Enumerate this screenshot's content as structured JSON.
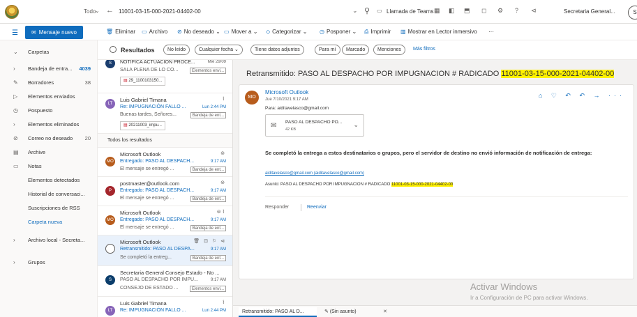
{
  "topbar": {
    "scope": "Todo",
    "search_value": "11001-03-15-000-2021-04402-00",
    "teams_label": "Llamada de Teams",
    "user": "Secretaria General...",
    "avatar": "S"
  },
  "commands": {
    "new_mail": "Mensaje nuevo",
    "delete": "Eliminar",
    "archive": "Archivo",
    "junk": "No deseado",
    "move": "Mover a",
    "categorize": "Categorizar",
    "snooze": "Posponer",
    "print": "Imprimir",
    "immersive": "Mostrar en Lector inmersivo",
    "more": "···"
  },
  "nav": {
    "folders": "Carpetas",
    "items": [
      {
        "icon": "chevron",
        "label": "Bandeja de entra...",
        "count": "4039"
      },
      {
        "icon": "pencil",
        "label": "Borradores",
        "count": "38"
      },
      {
        "icon": "send",
        "label": "Elementos enviados",
        "count": ""
      },
      {
        "icon": "clock",
        "label": "Pospuesto",
        "count": ""
      },
      {
        "icon": "chevron",
        "label": "Elementos eliminados",
        "count": ""
      },
      {
        "icon": "block",
        "label": "Correo no deseado",
        "count": "20"
      },
      {
        "icon": "archive",
        "label": "Archive",
        "count": ""
      },
      {
        "icon": "note",
        "label": "Notas",
        "count": ""
      },
      {
        "icon": "",
        "label": "Elementos detectados",
        "count": ""
      },
      {
        "icon": "",
        "label": "Historial de conversaci...",
        "count": ""
      },
      {
        "icon": "",
        "label": "Suscripciones de RSS",
        "count": ""
      },
      {
        "icon": "",
        "label": "Carpeta nueva",
        "count": ""
      }
    ],
    "local": "Archivo local - Secreta...",
    "groups": "Grupos"
  },
  "filters": {
    "title": "Resultados",
    "chips": [
      "No leído",
      "Cualquier fecha ⌄",
      "Tiene datos adjuntos",
      "Para mí",
      "Marcado",
      "Menciones"
    ],
    "more": "Más filtros"
  },
  "messages": {
    "m0": {
      "subject": "NOTIFICA ACTUACION PROCE...",
      "time": "Mié 29/09",
      "preview": "SALA PLENA DE LO CO...",
      "tag": "Elementos envi...",
      "attach": "29_1100103150..."
    },
    "m1": {
      "initials": "LT",
      "from": "Luis Gabriel Timana",
      "subject": "Re: IMPUGNACIÓN FALLO ...",
      "time": "Lun 2:44 PM",
      "preview": "Buenas tardes, Señores...",
      "tag": "Bandeja de ent...",
      "attach": "20211003_impu..."
    },
    "section": "Todos los resultados",
    "m2": {
      "initials": "MO",
      "from": "Microsoft Outlook",
      "subject": "Entregado: PASO AL DESPACH...",
      "time": "9:17 AM",
      "preview": "El mensaje se entregó ...",
      "tag": "Bandeja de ent..."
    },
    "m3": {
      "initials": "P",
      "from": "postmaster@outlook.com",
      "subject": "Entregado: PASO AL DESPACH...",
      "time": "9:17 AM",
      "preview": "El mensaje se entregó ...",
      "tag": "Bandeja de ent..."
    },
    "m4": {
      "initials": "MO",
      "from": "Microsoft Outlook",
      "subject": "Entregado: PASO AL DESPACH...",
      "time": "9:17 AM",
      "preview": "El mensaje se entregó ...",
      "tag": "Bandeja de ent..."
    },
    "m5": {
      "from": "Microsoft Outlook",
      "subject": "Retransmitido: PASO AL DESPA...",
      "time": "9:17 AM",
      "preview": "Se completó la entreg...",
      "tag": "Bandeja de ent..."
    },
    "m6": {
      "initials": "S",
      "from": "Secretaria General Consejo Estado - No ...",
      "subject": "PASO AL DESPACHO POR IMPU...",
      "time": "9:17 AM",
      "preview": "CONSEJO DE ESTADO ...",
      "tag": "Elementos envi..."
    },
    "m7": {
      "initials": "LT",
      "from": "Luis Gabriel Timana",
      "subject": "Re: IMPUGNACIÓN FALLO ...",
      "time": "Lun 2:44 PM"
    }
  },
  "reading": {
    "subject_prefix": "Retransmitido: PASO AL DESPACHO POR IMPUGNACION # RADICADO",
    "subject_hl": "11001-03-15-000-2021-04402-00",
    "avatar": "MO",
    "from": "Microsoft Outlook",
    "date": "Jue 7/10/2021 9:17 AM",
    "to": "Para: aiditavelasco@gmail.com",
    "attachment_name": "PASO AL DESPACHO PO...",
    "attachment_size": "42 KB",
    "body_title": "Se completó la entrega a estos destinatarios o grupos, pero el servidor de destino no envió información de notificación de entrega:",
    "link": "aiditavelasco@gmail.com (aiditavelasco@gmail.com)",
    "asunto_prefix": "Asunto: PASO AL DESPACHO POR IMPUGNACION # RADICADO",
    "asunto_hl": "11001-03-15-000-2021-04402-00",
    "reply": "Responder",
    "forward": "Reenviar"
  },
  "watermark": {
    "line1": "Activar Windows",
    "line2": "Ir a Configuración de PC para activar Windows."
  },
  "tabs": {
    "t1": "Retransmitido: PASO AL D...",
    "t2": "(Sin asunto)",
    "close": "✕"
  }
}
